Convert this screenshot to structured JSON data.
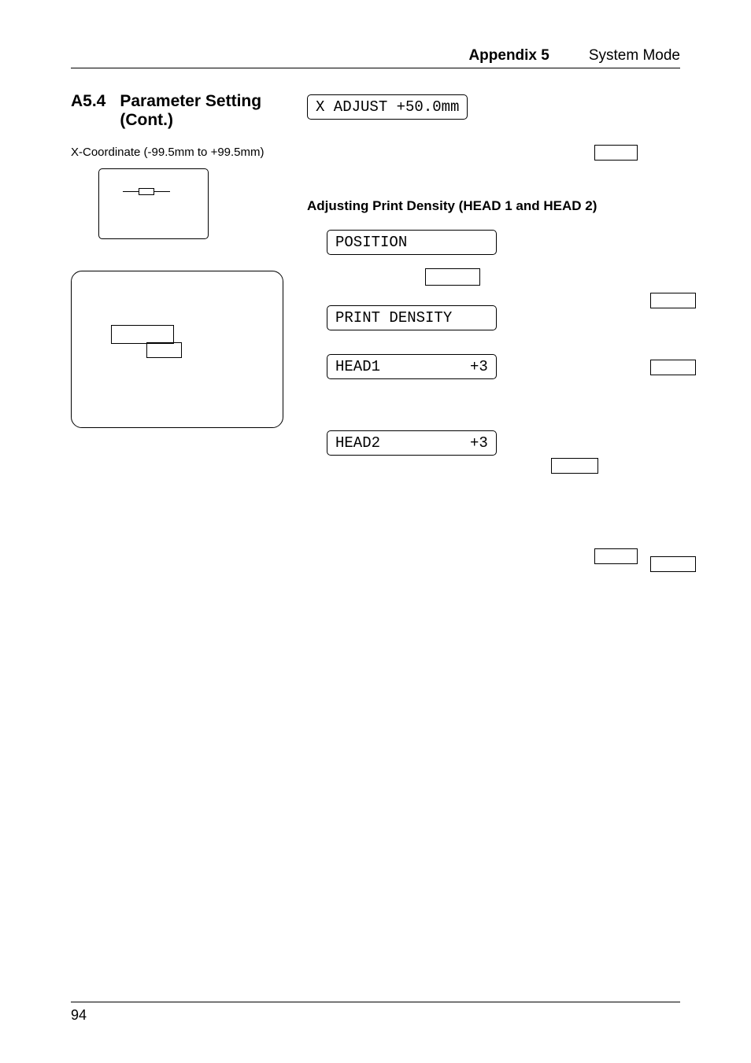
{
  "header": {
    "appendix": "Appendix 5",
    "mode": "System Mode"
  },
  "section": {
    "number": "A5.4",
    "title": "Parameter Setting (Cont.)"
  },
  "left": {
    "coord_label": "X-Coordinate (-99.5mm to +99.5mm)"
  },
  "right": {
    "display1": "X ADJUST +50.0mm",
    "subheading": "Adjusting Print Density (HEAD 1 and HEAD 2)",
    "display2": "POSITION         ",
    "display3": "PRINT DENSITY    ",
    "display4": "HEAD1          +3",
    "display5": "HEAD2          +3"
  },
  "footer": {
    "page": "94"
  }
}
